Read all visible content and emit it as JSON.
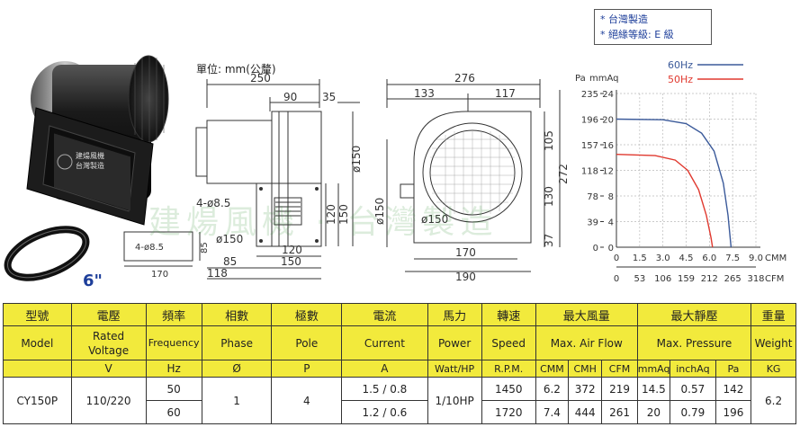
{
  "notes": [
    "* 台灣製造",
    "* 絕緣等級: E 級"
  ],
  "drawing": {
    "unit_label": "單位: mm(公釐)",
    "side": {
      "d250": "250",
      "d90": "90",
      "d35": "35",
      "d26": "26",
      "d150v": "ø150",
      "d120": "120",
      "d150": "150",
      "d85": "85",
      "d118": "118",
      "d150b": "150",
      "d120b": "120",
      "hole": "4-ø8.5",
      "outlet": "ø150"
    },
    "flange": {
      "hole": "4-ø8.5",
      "d85": "85",
      "d170": "170",
      "size_label": "6\""
    },
    "front": {
      "d276": "276",
      "d133": "133",
      "d117": "117",
      "d105": "105",
      "d272": "272",
      "d130": "130",
      "d37": "37",
      "d150": "ø150",
      "d150b": "ø150",
      "d170": "170",
      "d190": "190"
    }
  },
  "watermark": "建煬風機 · 台灣製造",
  "chart_data": {
    "type": "line",
    "x_units": [
      "CMM",
      "CFM"
    ],
    "x_ticks_cmm": [
      "0",
      "1.5",
      "3.0",
      "4.5",
      "6.0",
      "7.5",
      "9.0"
    ],
    "x_ticks_cfm": [
      "0",
      "53",
      "106",
      "159",
      "212",
      "265",
      "318"
    ],
    "y_units": [
      "Pa",
      "mmAq"
    ],
    "y_ticks_pa": [
      "0",
      "39",
      "78",
      "118",
      "157",
      "196",
      "235"
    ],
    "y_ticks_mmaq": [
      "0",
      "4",
      "8",
      "12",
      "16",
      "20",
      "24"
    ],
    "xlim": [
      0,
      9.0
    ],
    "ylim": [
      0,
      24
    ],
    "series": [
      {
        "name": "60Hz",
        "color": "#3b5a9a",
        "points": [
          [
            0,
            20
          ],
          [
            3.0,
            19.9
          ],
          [
            4.5,
            19.3
          ],
          [
            5.5,
            17.8
          ],
          [
            6.3,
            15
          ],
          [
            6.9,
            10
          ],
          [
            7.2,
            5
          ],
          [
            7.4,
            0
          ]
        ]
      },
      {
        "name": "50Hz",
        "color": "#e0392f",
        "points": [
          [
            0,
            14.5
          ],
          [
            2.5,
            14.3
          ],
          [
            3.8,
            13.6
          ],
          [
            4.6,
            12
          ],
          [
            5.3,
            9
          ],
          [
            5.8,
            5
          ],
          [
            6.1,
            1.5
          ],
          [
            6.2,
            0
          ]
        ]
      }
    ]
  },
  "table": {
    "headers_zh": [
      "型號",
      "電壓",
      "頻率",
      "相數",
      "極數",
      "電流",
      "馬力",
      "轉速",
      "最大風量",
      "最大靜壓",
      "重量"
    ],
    "headers_en": [
      "Model",
      "Rated Voltage",
      "Frequency",
      "Phase",
      "Pole",
      "Current",
      "Power",
      "Speed",
      "Max. Air Flow",
      "Max. Pressure",
      "Weight"
    ],
    "units": [
      "V",
      "Hz",
      "Ø",
      "P",
      "A",
      "Watt/HP",
      "R.P.M.",
      "CMM",
      "CMH",
      "CFM",
      "mmAq",
      "inchAq",
      "Pa",
      "KG"
    ],
    "row": {
      "model": "CY150P",
      "voltage": "110/220",
      "phase": "1",
      "pole": "4",
      "power": "1/10HP",
      "weight": "6.2",
      "rows": [
        {
          "freq": "50",
          "current": "1.5 / 0.8",
          "rpm": "1450",
          "cmm": "6.2",
          "cmh": "372",
          "cfm": "219",
          "mmaq": "14.5",
          "inchaq": "0.57",
          "pa": "142"
        },
        {
          "freq": "60",
          "current": "1.2 / 0.6",
          "rpm": "1720",
          "cmm": "7.4",
          "cmh": "444",
          "cfm": "261",
          "mmaq": "20",
          "inchaq": "0.79",
          "pa": "196"
        }
      ]
    }
  }
}
